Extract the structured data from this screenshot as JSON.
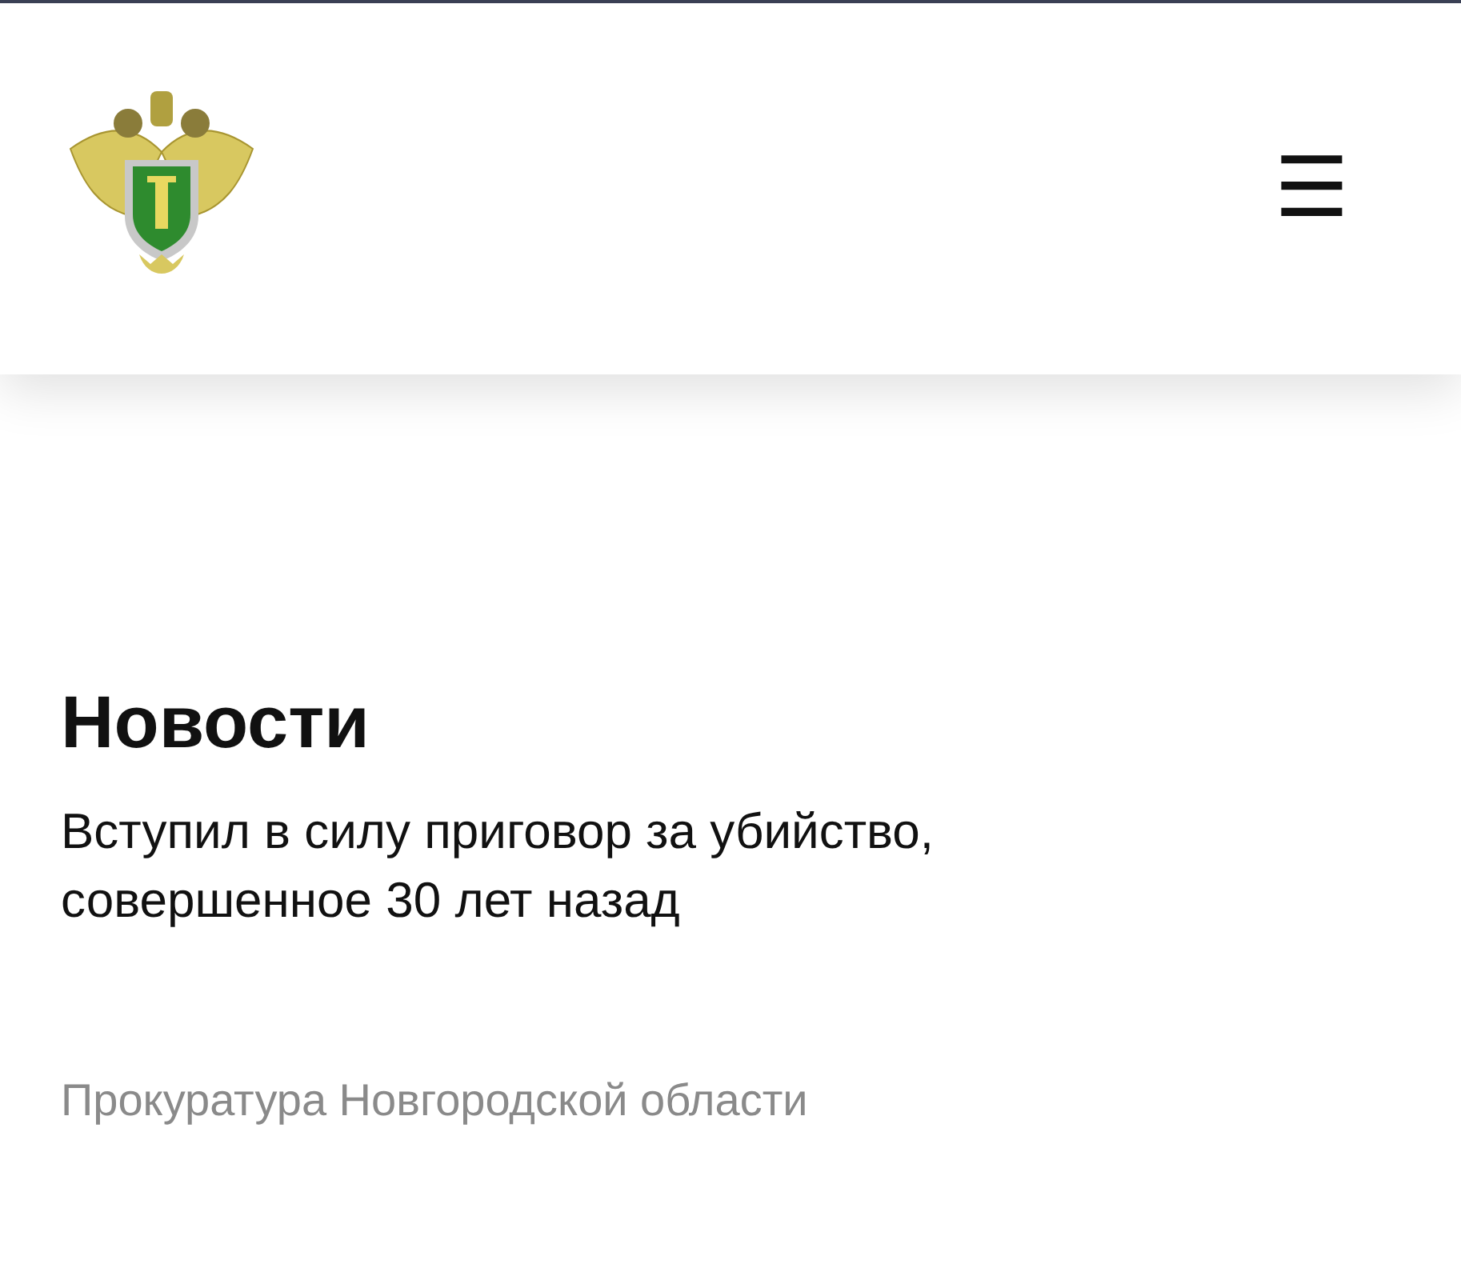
{
  "header": {
    "menu_icon": "☰"
  },
  "section": {
    "title": "Новости"
  },
  "article": {
    "headline": "Вступил в силу приговор за убийство, совершенное 30 лет назад",
    "source": "Прокуратура Новгородской области"
  }
}
